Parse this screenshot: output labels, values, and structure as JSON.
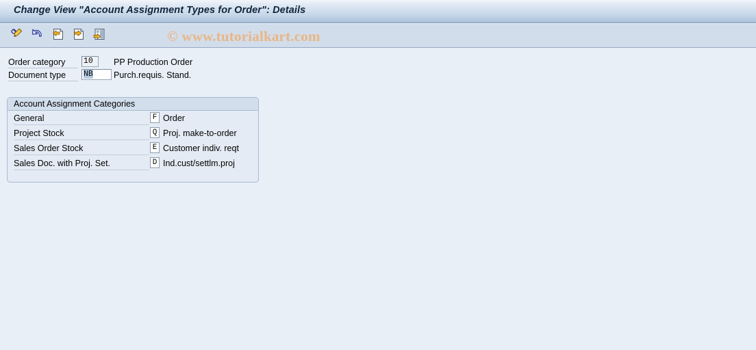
{
  "window": {
    "title": "Change View \"Account Assignment Types for Order\": Details"
  },
  "toolbar": {
    "watermark": "© www.tutorialkart.com",
    "buttons": [
      {
        "name": "display-change-icon",
        "tooltip": "Display/Change"
      },
      {
        "name": "undo-icon",
        "tooltip": "Undo"
      },
      {
        "name": "previous-entry-icon",
        "tooltip": "Previous Entry"
      },
      {
        "name": "next-entry-icon",
        "tooltip": "Next Entry"
      },
      {
        "name": "overview-list-icon",
        "tooltip": "Overview"
      }
    ]
  },
  "header_form": {
    "order_category": {
      "label": "Order category",
      "value": "10",
      "description": "PP Production Order"
    },
    "document_type": {
      "label": "Document type",
      "value": "NB",
      "description": "Purch.requis. Stand."
    }
  },
  "groupbox": {
    "title": "Account Assignment Categories",
    "rows": [
      {
        "label": "General",
        "code": "F",
        "description": "Order"
      },
      {
        "label": "Project Stock",
        "code": "Q",
        "description": "Proj. make-to-order"
      },
      {
        "label": "Sales Order Stock",
        "code": "E",
        "description": "Customer indiv. reqt"
      },
      {
        "label": "Sales Doc. with Proj. Set.",
        "code": "D",
        "description": "Ind.cust/settlm.proj"
      }
    ]
  },
  "colors": {
    "title_text": "#11243c",
    "toolbar_bg": "#d2ddeb",
    "content_bg": "#e9eff7",
    "watermark": "#e9b684",
    "selection": "#b6cbe4",
    "groupbox_border": "#a8bad0"
  }
}
